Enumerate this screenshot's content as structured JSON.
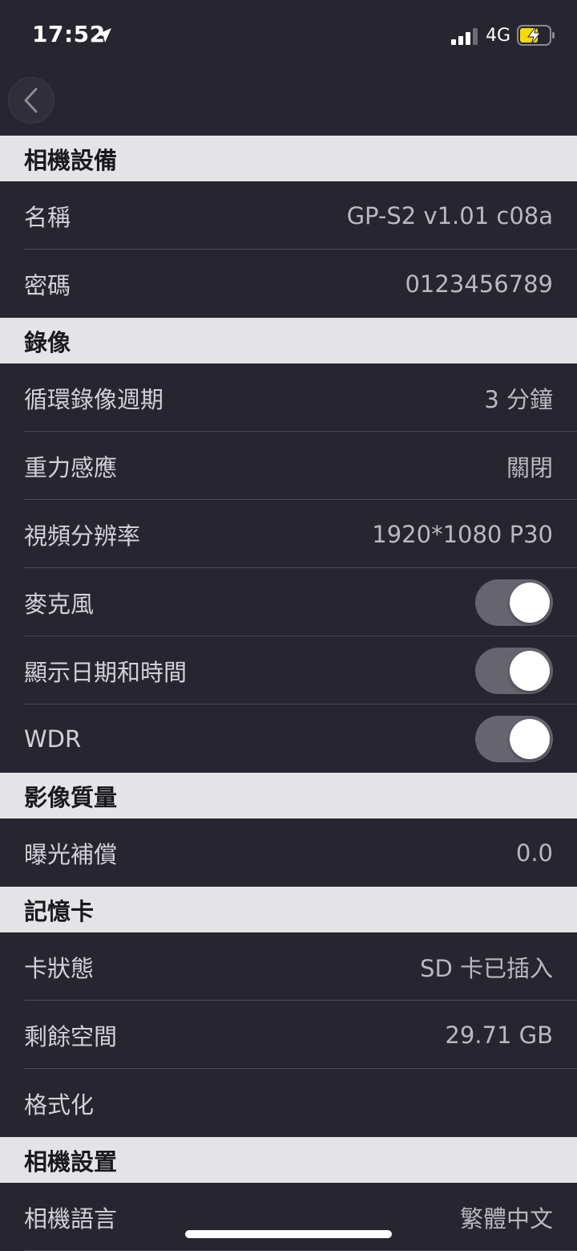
{
  "status_bar": {
    "time": "17:52",
    "network": "4G",
    "signal_bars": 3,
    "battery_state": "charging"
  },
  "nav": {
    "back_icon": "chevron-left-icon"
  },
  "sections": [
    {
      "title": "相機設備",
      "rows": [
        {
          "label": "名稱",
          "value": "GP-S2 v1.01 c08a"
        },
        {
          "label": "密碼",
          "value": "0123456789"
        }
      ]
    },
    {
      "title": "錄像",
      "rows": [
        {
          "label": "循環錄像週期",
          "value": "3 分鐘"
        },
        {
          "label": "重力感應",
          "value": "關閉"
        },
        {
          "label": "視頻分辨率",
          "value": "1920*1080 P30"
        },
        {
          "label": "麥克風",
          "toggle": true
        },
        {
          "label": "顯示日期和時間",
          "toggle": true
        },
        {
          "label": "WDR",
          "toggle": true
        }
      ]
    },
    {
      "title": "影像質量",
      "rows": [
        {
          "label": "曝光補償",
          "value": "0.0"
        }
      ]
    },
    {
      "title": "記憶卡",
      "rows": [
        {
          "label": "卡狀態",
          "value": "SD 卡已插入"
        },
        {
          "label": "剩餘空間",
          "value": "29.71 GB"
        },
        {
          "label": "格式化",
          "value": ""
        }
      ]
    },
    {
      "title": "相機設置",
      "rows": [
        {
          "label": "相機語言",
          "value": "繁體中文"
        }
      ]
    }
  ],
  "colors": {
    "background": "#262530",
    "section_header": "#e4e4e6",
    "toggle_on": "#65646f",
    "battery_charging": "#f5d90a"
  }
}
